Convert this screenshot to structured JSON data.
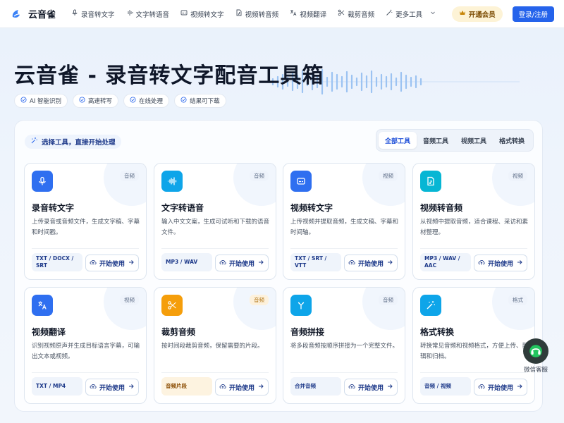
{
  "brand": {
    "name": "云音雀"
  },
  "nav": {
    "items": [
      {
        "label": "录音转文字",
        "icon": "mic-icon"
      },
      {
        "label": "文字转语音",
        "icon": "waveform-icon"
      },
      {
        "label": "视频转文字",
        "icon": "subtitles-icon"
      },
      {
        "label": "视频转音频",
        "icon": "file-music-icon"
      },
      {
        "label": "视频翻译",
        "icon": "translate-icon"
      },
      {
        "label": "裁剪音频",
        "icon": "scissors-icon"
      },
      {
        "label": "更多工具",
        "icon": "magic-wand-icon"
      }
    ],
    "vip_label": "开通会员",
    "login_label": "登录/注册"
  },
  "hero": {
    "title": "云音雀 - 录音转文字配音工具箱",
    "chips": [
      "AI 智能识别",
      "高速转写",
      "在线处理",
      "结果可下载"
    ]
  },
  "panel": {
    "heading": "选择工具，直接开始处理",
    "tabs": [
      {
        "label": "全部工具",
        "active": true
      },
      {
        "label": "音频工具",
        "active": false
      },
      {
        "label": "视频工具",
        "active": false
      },
      {
        "label": "格式转换",
        "active": false
      }
    ]
  },
  "cards": [
    {
      "title": "录音转文字",
      "tag": "音频",
      "desc": "上传录音或音频文件，生成文字稿、字幕和时间戳。",
      "format": "TXT / DOCX / SRT",
      "start": "开始使用",
      "icon": "mic-icon",
      "color": "#2f6ff0"
    },
    {
      "title": "文字转语音",
      "tag": "音频",
      "desc": "输入中文文案，生成可试听和下载的语音文件。",
      "format": "MP3 / WAV",
      "start": "开始使用",
      "icon": "waveform-icon",
      "color": "#0ea5e9"
    },
    {
      "title": "视频转文字",
      "tag": "视频",
      "desc": "上传视频并提取音频，生成文稿、字幕和时间轴。",
      "format": "TXT / SRT / VTT",
      "start": "开始使用",
      "icon": "subtitles-icon",
      "color": "#2f6ff0"
    },
    {
      "title": "视频转音频",
      "tag": "视频",
      "desc": "从视频中提取音频，适合课程、采访和素材整理。",
      "format": "MP3 / WAV / AAC",
      "start": "开始使用",
      "icon": "file-music-icon",
      "color": "#06b6d4"
    },
    {
      "title": "视频翻译",
      "tag": "视频",
      "desc": "识别视频原声并生成目标语言字幕，可输出文本或视频。",
      "format": "TXT / MP4",
      "start": "开始使用",
      "icon": "translate-icon",
      "color": "#2f6ff0"
    },
    {
      "title": "裁剪音频",
      "tag": "音频",
      "desc": "按时间段裁剪音频，保留需要的片段。",
      "format": "音频片段",
      "start": "开始使用",
      "icon": "scissors-icon",
      "color": "#f59e0b"
    },
    {
      "title": "音频拼接",
      "tag": "音频",
      "desc": "将多段音频按顺序拼接为一个完整文件。",
      "format": "合并音频",
      "start": "开始使用",
      "icon": "merge-icon",
      "color": "#0ea5e9"
    },
    {
      "title": "格式转换",
      "tag": "格式",
      "desc": "转换常见音频和视频格式，方便上传、剪辑和归档。",
      "format": "音频 / 视频",
      "start": "开始使用",
      "icon": "magic-wand-icon",
      "color": "#0ea5e9"
    }
  ],
  "service": {
    "label": "微信客服"
  }
}
